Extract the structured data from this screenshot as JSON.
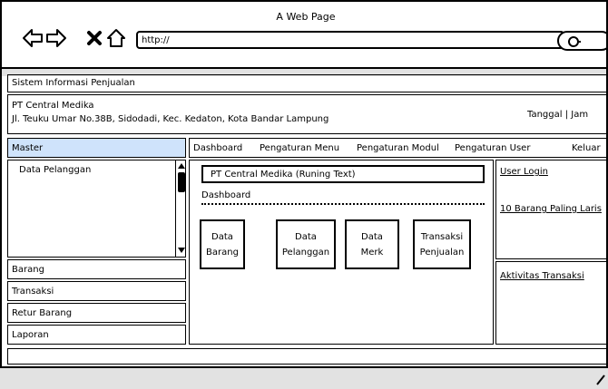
{
  "window": {
    "title": "A Web Page"
  },
  "browser": {
    "url": "http://",
    "icons": [
      "back-arrow-icon",
      "forward-arrow-icon",
      "close-x-icon",
      "home-icon",
      "search-icon"
    ]
  },
  "app": {
    "title": "Sistem Informasi Penjualan",
    "company": "PT Central Medika",
    "address": "Jl. Teuku Umar No.38B, Sidodadi, Kec. Kedaton, Kota Bandar Lampung",
    "date_time": "Tanggal | Jam"
  },
  "sidebar": {
    "items": [
      {
        "label": "Master"
      },
      {
        "label": "Barang"
      },
      {
        "label": "Transaksi"
      },
      {
        "label": "Retur Barang"
      },
      {
        "label": "Laporan"
      }
    ],
    "submenu": [
      "Data Pelanggan"
    ],
    "active_color": "#cfe3fb"
  },
  "menu": {
    "items": [
      "Dashboard",
      "Pengaturan Menu",
      "Pengaturan Modul",
      "Pengaturan User",
      "Keluar"
    ]
  },
  "main": {
    "running_text": "PT Central Medika (Runing Text)",
    "section_label": "Dashboard",
    "cards": [
      {
        "line1": "Data",
        "line2": "Barang"
      },
      {
        "line1": "Data",
        "line2": "Pelanggan"
      },
      {
        "line1": "Data",
        "line2": "Merk"
      },
      {
        "line1": "Transaksi",
        "line2": "Penjualan"
      }
    ]
  },
  "right_panel": {
    "user_login": "User Login",
    "top_items": "10 Barang Paling Laris",
    "activity": "Aktivitas Transaksi"
  },
  "colors": {
    "chrome_gray": "#e2e2e2"
  }
}
